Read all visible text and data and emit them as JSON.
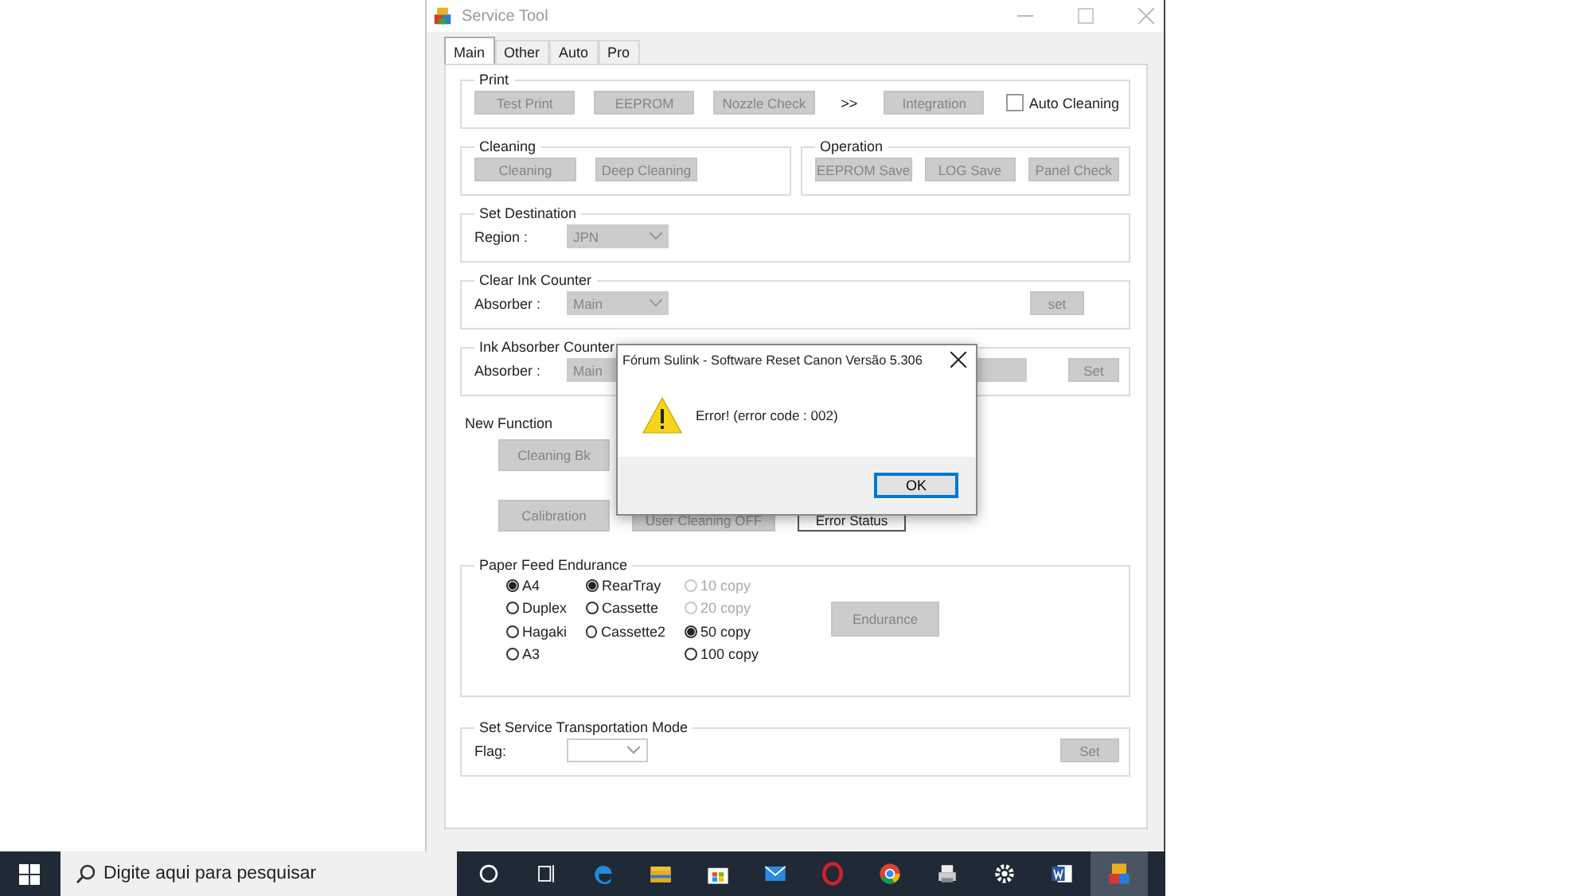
{
  "window": {
    "title": "Service Tool"
  },
  "tabs": [
    {
      "label": "Main",
      "selected": true
    },
    {
      "label": "Other",
      "selected": false
    },
    {
      "label": "Auto",
      "selected": false
    },
    {
      "label": "Pro",
      "selected": false
    }
  ],
  "print": {
    "title": "Print",
    "buttons": [
      "Test Print",
      "EEPROM",
      "Nozzle Check"
    ],
    "separator": ">>",
    "integration_button": "Integration",
    "auto_cleaning": {
      "label": "Auto Cleaning",
      "checked": false
    }
  },
  "cleaning": {
    "title": "Cleaning",
    "buttons": [
      "Cleaning",
      "Deep Cleaning"
    ]
  },
  "operation": {
    "title": "Operation",
    "buttons": [
      "EEPROM Save",
      "LOG Save",
      "Panel Check"
    ]
  },
  "set_destination": {
    "title": "Set Destination",
    "label": "Region :",
    "value": "JPN"
  },
  "clear_ink_counter": {
    "title": "Clear Ink Counter",
    "label": "Absorber :",
    "value": "Main",
    "button": "set"
  },
  "ink_absorber_counter": {
    "title": "Ink Absorber Counter",
    "label": "Absorber :",
    "value": "Main",
    "button": "Set"
  },
  "new_function": {
    "title": "New Function",
    "buttons": [
      {
        "label": "Cleaning Bk",
        "disabled": true
      },
      {
        "label": "Calibration",
        "disabled": true
      },
      {
        "label": "User Cleaning OFF",
        "disabled": true
      },
      {
        "label": "Error Status",
        "disabled": false
      }
    ]
  },
  "paper_feed_endurance": {
    "title": "Paper Feed Endurance",
    "columns": [
      [
        {
          "label": "A4",
          "selected": true,
          "disabled": false
        },
        {
          "label": "Duplex",
          "selected": false,
          "disabled": false
        },
        {
          "label": "Hagaki",
          "selected": false,
          "disabled": false
        },
        {
          "label": "A3",
          "selected": false,
          "disabled": false
        }
      ],
      [
        {
          "label": "RearTray",
          "selected": true,
          "disabled": false
        },
        {
          "label": "Cassette",
          "selected": false,
          "disabled": false
        },
        {
          "label": "Cassette2",
          "selected": false,
          "disabled": false
        }
      ],
      [
        {
          "label": "10 copy",
          "selected": false,
          "disabled": true
        },
        {
          "label": "20 copy",
          "selected": false,
          "disabled": true
        },
        {
          "label": "50 copy",
          "selected": true,
          "disabled": false
        },
        {
          "label": "100 copy",
          "selected": false,
          "disabled": false
        }
      ]
    ],
    "button": "Endurance"
  },
  "transportation_mode": {
    "title": "Set Service Transportation Mode",
    "label": "Flag:",
    "button": "Set"
  },
  "dialog": {
    "title": "Fórum Sulink - Software Reset Canon Versão 5.306",
    "message": "Error! (error code : 002)",
    "button": "OK"
  },
  "taskbar": {
    "search_placeholder": "Digite aqui para pesquisar",
    "apps": [
      {
        "kind": "cortana",
        "selected": false
      },
      {
        "kind": "taskview",
        "selected": false
      },
      {
        "kind": "browser",
        "selected": false
      },
      {
        "kind": "folder",
        "selected": false
      },
      {
        "kind": "store",
        "selected": false
      },
      {
        "kind": "mail",
        "selected": false
      },
      {
        "kind": "ring",
        "selected": false
      },
      {
        "kind": "chrome",
        "selected": false
      },
      {
        "kind": "printer",
        "selected": false
      },
      {
        "kind": "gear",
        "selected": false
      },
      {
        "kind": "word",
        "selected": false
      },
      {
        "kind": "tool",
        "selected": true
      }
    ]
  }
}
